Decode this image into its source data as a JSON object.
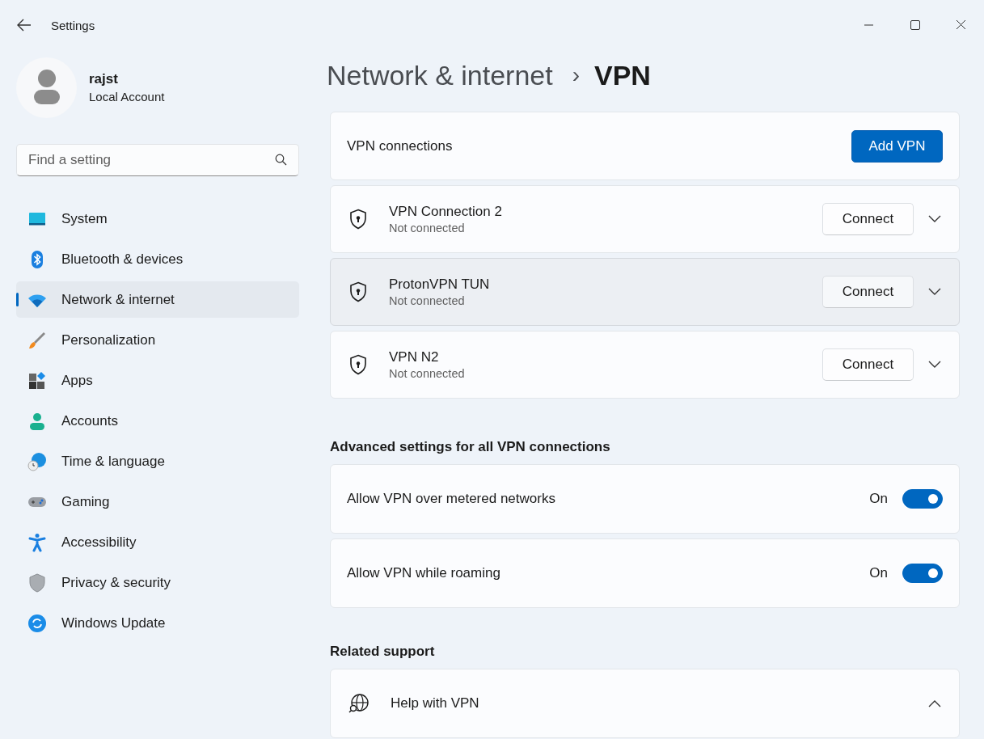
{
  "window": {
    "title": "Settings"
  },
  "profile": {
    "name": "rajst",
    "account_type": "Local Account"
  },
  "search": {
    "placeholder": "Find a setting"
  },
  "nav": [
    {
      "label": "System",
      "selected": false
    },
    {
      "label": "Bluetooth & devices",
      "selected": false
    },
    {
      "label": "Network & internet",
      "selected": true
    },
    {
      "label": "Personalization",
      "selected": false
    },
    {
      "label": "Apps",
      "selected": false
    },
    {
      "label": "Accounts",
      "selected": false
    },
    {
      "label": "Time & language",
      "selected": false
    },
    {
      "label": "Gaming",
      "selected": false
    },
    {
      "label": "Accessibility",
      "selected": false
    },
    {
      "label": "Privacy & security",
      "selected": false
    },
    {
      "label": "Windows Update",
      "selected": false
    }
  ],
  "breadcrumb": {
    "parent": "Network & internet",
    "separator": "›",
    "current": "VPN"
  },
  "vpn_header": {
    "label": "VPN connections",
    "button": "Add VPN"
  },
  "connections": [
    {
      "name": "VPN Connection 2",
      "status": "Not connected",
      "button": "Connect",
      "hovered": false
    },
    {
      "name": "ProtonVPN TUN",
      "status": "Not connected",
      "button": "Connect",
      "hovered": true
    },
    {
      "name": "VPN N2",
      "status": "Not connected",
      "button": "Connect",
      "hovered": false
    }
  ],
  "advanced": {
    "heading": "Advanced settings for all VPN connections",
    "settings": [
      {
        "label": "Allow VPN over metered networks",
        "state_text": "On",
        "on": true
      },
      {
        "label": "Allow VPN while roaming",
        "state_text": "On",
        "on": true
      }
    ]
  },
  "related": {
    "heading": "Related support",
    "items": [
      {
        "label": "Help with VPN",
        "expanded": true
      }
    ]
  }
}
